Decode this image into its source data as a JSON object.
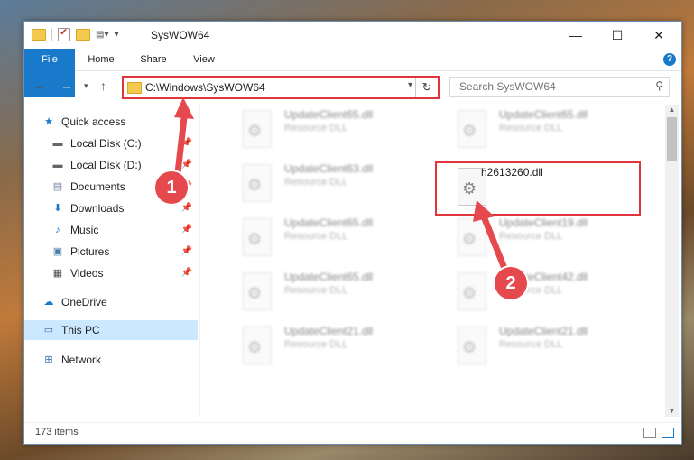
{
  "window": {
    "title": "SysWOW64",
    "controls": {
      "minimize": "—",
      "maximize": "☐",
      "close": "✕"
    }
  },
  "ribbon": {
    "tabs": [
      "File",
      "Home",
      "Share",
      "View"
    ],
    "help": "?"
  },
  "address_bar": {
    "path": "C:\\Windows\\SysWOW64"
  },
  "search": {
    "placeholder": "Search SysWOW64"
  },
  "sidebar": {
    "items": [
      {
        "label": "Quick access",
        "icon": "star-icon",
        "pinned": false
      },
      {
        "label": "Local Disk (C:)",
        "icon": "drive-icon",
        "pinned": true
      },
      {
        "label": "Local Disk (D:)",
        "icon": "drive-icon",
        "pinned": true
      },
      {
        "label": "Documents",
        "icon": "documents-icon",
        "pinned": true
      },
      {
        "label": "Downloads",
        "icon": "download-icon",
        "pinned": true
      },
      {
        "label": "Music",
        "icon": "music-icon",
        "pinned": true
      },
      {
        "label": "Pictures",
        "icon": "pictures-icon",
        "pinned": true
      },
      {
        "label": "Videos",
        "icon": "videos-icon",
        "pinned": true
      },
      {
        "label": "OneDrive",
        "icon": "cloud-icon",
        "pinned": false
      },
      {
        "label": "This PC",
        "icon": "computer-icon",
        "pinned": false,
        "selected": true
      },
      {
        "label": "Network",
        "icon": "network-icon",
        "pinned": false
      }
    ]
  },
  "files": {
    "left": [
      {
        "name": "UpdateClient65.dll",
        "desc": "Resource DLL"
      },
      {
        "name": "UpdateClient63.dll",
        "desc": "Resource DLL"
      },
      {
        "name": "UpdateClient65.dll",
        "desc": "Resource DLL"
      },
      {
        "name": "UpdateClient65.dll",
        "desc": "Resource DLL"
      },
      {
        "name": "UpdateClient21.dll",
        "desc": "Resource DLL"
      }
    ],
    "right": [
      {
        "name": "UpdateClient65.dll",
        "desc": "Resource DLL"
      },
      {
        "name": "h2613260.dll",
        "desc": "",
        "highlighted": true
      },
      {
        "name": "UpdateClient19.dll",
        "desc": "Resource DLL"
      },
      {
        "name": "UpdateClient42.dll",
        "desc": "Resource DLL"
      },
      {
        "name": "UpdateClient21.dll",
        "desc": "Resource DLL"
      }
    ]
  },
  "status": {
    "item_count": "173 items"
  },
  "annotations": {
    "marker1": "1",
    "marker2": "2",
    "accent": "#e5484d"
  }
}
